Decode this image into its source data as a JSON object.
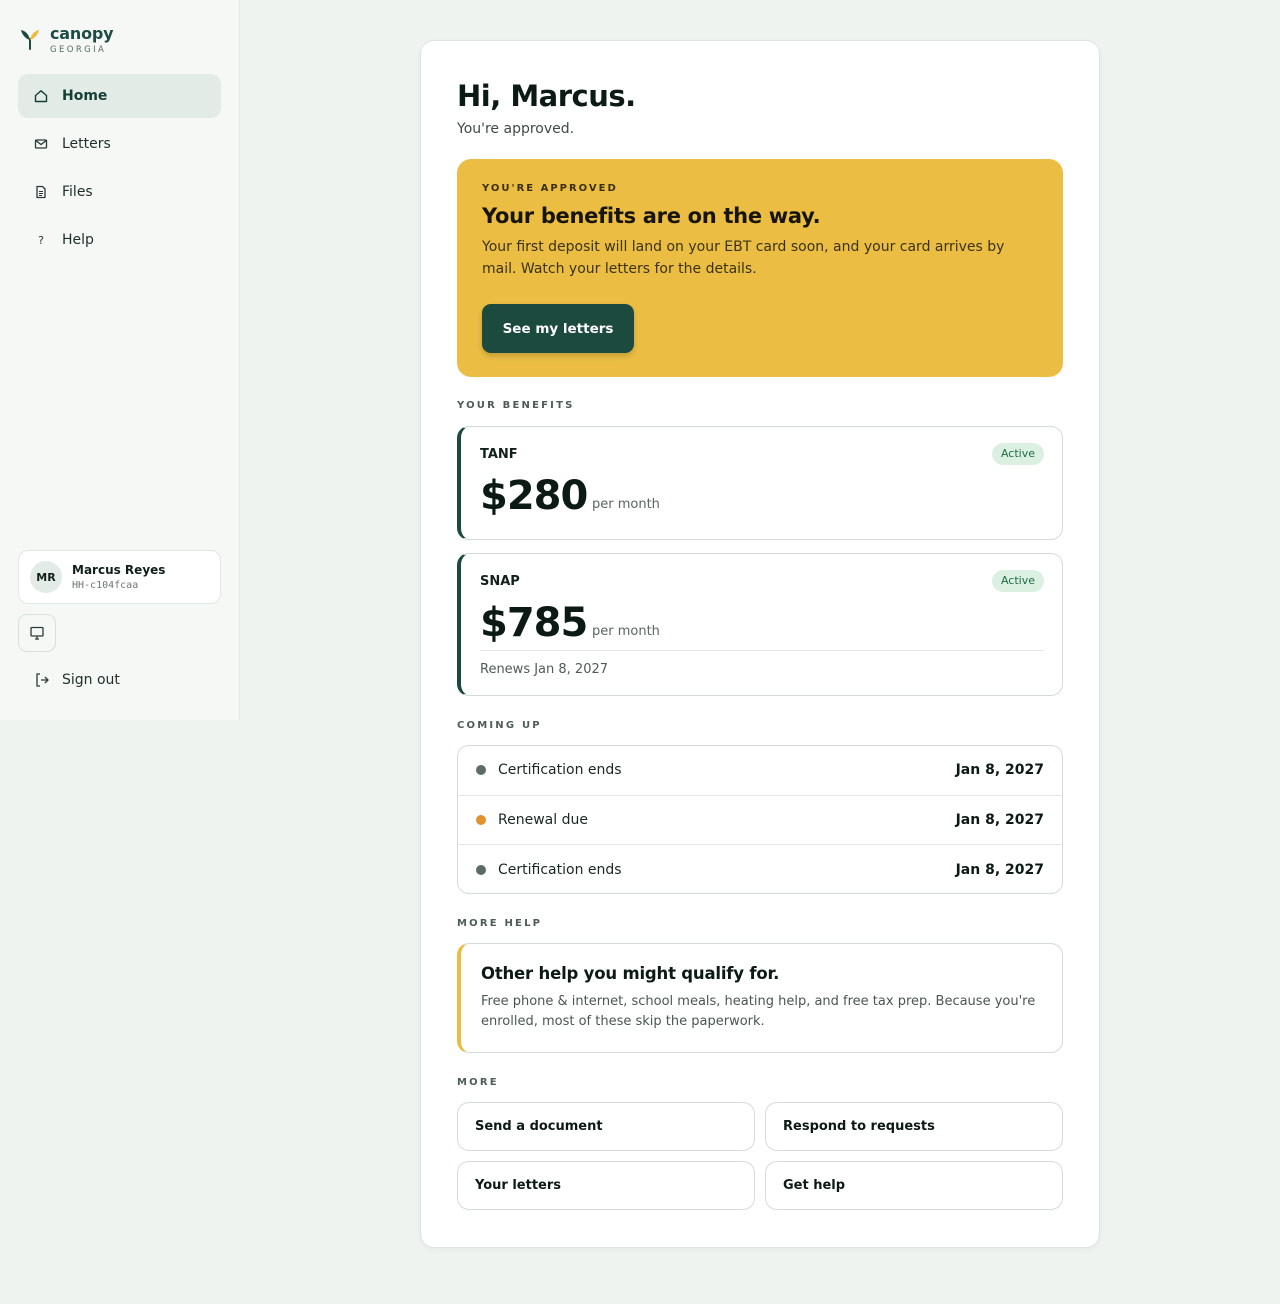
{
  "brand": {
    "name": "canopy",
    "sub": "GEORGIA"
  },
  "nav": [
    {
      "label": "Home",
      "icon": "home-icon",
      "active": true
    },
    {
      "label": "Letters",
      "icon": "mail-icon",
      "active": false
    },
    {
      "label": "Files",
      "icon": "document-icon",
      "active": false
    },
    {
      "label": "Help",
      "icon": "question-icon",
      "active": false
    }
  ],
  "user": {
    "initials": "MR",
    "name": "Marcus Reyes",
    "id": "HH-c104fcaa"
  },
  "signout_label": "Sign out",
  "greeting": "Hi, Marcus.",
  "subgreeting": "You're approved.",
  "hero": {
    "eyebrow": "YOU'RE APPROVED",
    "title": "Your benefits are on the way.",
    "text": "Your first deposit will land on your EBT card soon, and your card arrives by mail. Watch your letters for the details.",
    "button": "See my letters"
  },
  "sections": {
    "benefits": "YOUR BENEFITS",
    "coming_up": "COMING UP",
    "more_help": "MORE HELP",
    "more": "MORE"
  },
  "benefits": [
    {
      "name": "TANF",
      "status": "Active",
      "amount": "$280",
      "unit": "per month",
      "renews": ""
    },
    {
      "name": "SNAP",
      "status": "Active",
      "amount": "$785",
      "unit": "per month",
      "renews": "Renews Jan 8, 2027"
    }
  ],
  "upcoming": [
    {
      "label": "Certification ends",
      "date": "Jan 8, 2027",
      "dot_color": "#5d6b66"
    },
    {
      "label": "Renewal due",
      "date": "Jan 8, 2027",
      "dot_color": "#e0922e"
    },
    {
      "label": "Certification ends",
      "date": "Jan 8, 2027",
      "dot_color": "#5d6b66"
    }
  ],
  "more_help": {
    "title": "Other help you might qualify for.",
    "text": "Free phone & internet, school meals, heating help, and free tax prep. Because you're enrolled, most of these skip the paperwork."
  },
  "quick_actions": [
    "Send a document",
    "Respond to requests",
    "Your letters",
    "Get help"
  ],
  "colors": {
    "brand_dark": "#1d4a3f",
    "accent_yellow": "#ebbe43",
    "active_badge_bg": "#dcf0e2",
    "active_badge_text": "#1e6a45",
    "background": "#eef3ef"
  }
}
